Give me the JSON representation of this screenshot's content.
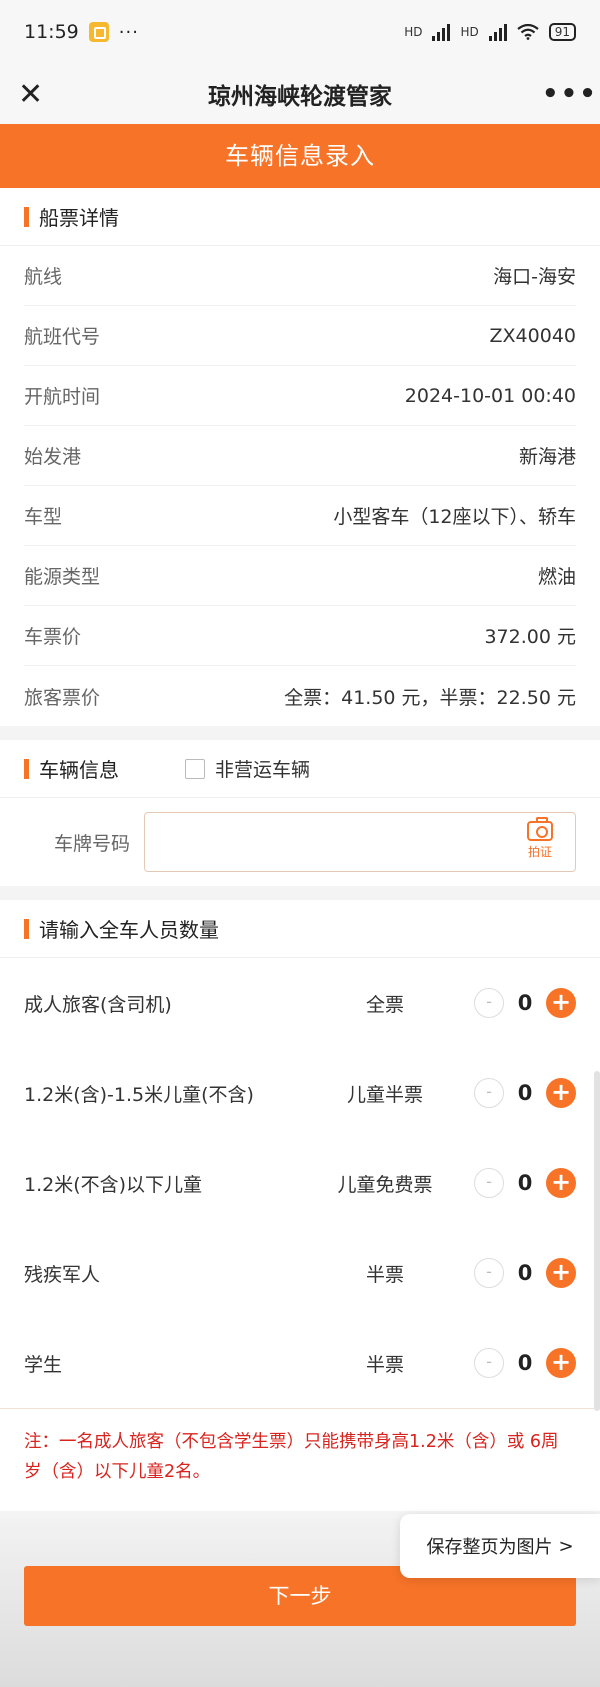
{
  "status": {
    "time": "11:59",
    "more": "···",
    "hd1": "HD",
    "hd2": "HD",
    "battery": "91"
  },
  "nav": {
    "close_icon": "close-icon",
    "title": "琼州海峡轮渡管家",
    "more_icon": "more-icon"
  },
  "banner": {
    "title": "车辆信息录入"
  },
  "ticket": {
    "title": "船票详情",
    "rows": [
      {
        "label": "航线",
        "value": "海口-海安"
      },
      {
        "label": "航班代号",
        "value": "ZX40040"
      },
      {
        "label": "开航时间",
        "value": "2024-10-01 00:40"
      },
      {
        "label": "始发港",
        "value": "新海港"
      },
      {
        "label": "车型",
        "value": "小型客车（12座以下）、轿车"
      },
      {
        "label": "能源类型",
        "value": "燃油"
      },
      {
        "label": "车票价",
        "value": "372.00 元"
      },
      {
        "label": "旅客票价",
        "value": "全票：41.50 元，半票：22.50 元"
      }
    ]
  },
  "vehicle": {
    "title": "车辆信息",
    "non_commercial_label": "非营运车辆",
    "plate_label": "车牌号码",
    "plate_value": "",
    "camera_label": "拍证"
  },
  "passengers": {
    "title": "请输入全车人员数量",
    "minus": "-",
    "plus": "+",
    "rows": [
      {
        "name": "成人旅客(含司机)",
        "type": "全票",
        "count": "0"
      },
      {
        "name": "1.2米(含)-1.5米儿童(不含)",
        "type": "儿童半票",
        "count": "0"
      },
      {
        "name": "1.2米(不含)以下儿童",
        "type": "儿童免费票",
        "count": "0"
      },
      {
        "name": "残疾军人",
        "type": "半票",
        "count": "0"
      },
      {
        "name": "学生",
        "type": "半票",
        "count": "0"
      }
    ],
    "note": "注：一名成人旅客（不包含学生票）只能携带身高1.2米（含）或 6周岁（含）以下儿童2名。"
  },
  "footer": {
    "next_label": "下一步",
    "save_label": "保存整页为图片",
    "save_arrow": ">"
  },
  "colors": {
    "accent": "#f67328",
    "warning": "#d8241f"
  }
}
